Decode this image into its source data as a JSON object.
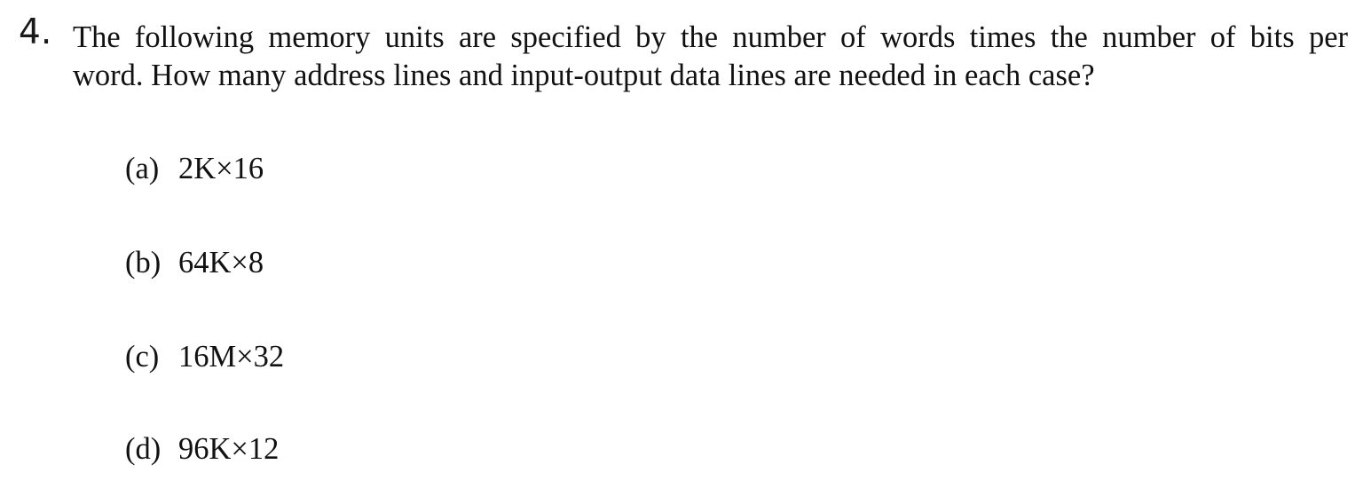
{
  "question": {
    "number": "4.",
    "line1": "The following memory units are specified by the number of words times the number of bits per",
    "line2": "word. How many address lines and input-output data lines are needed in each case?"
  },
  "options": [
    {
      "label": "(a)",
      "value": "2K×16"
    },
    {
      "label": "(b)",
      "value": "64K×8"
    },
    {
      "label": "(c)",
      "value": "16M×32"
    },
    {
      "label": "(d)",
      "value": "96K×12"
    }
  ]
}
